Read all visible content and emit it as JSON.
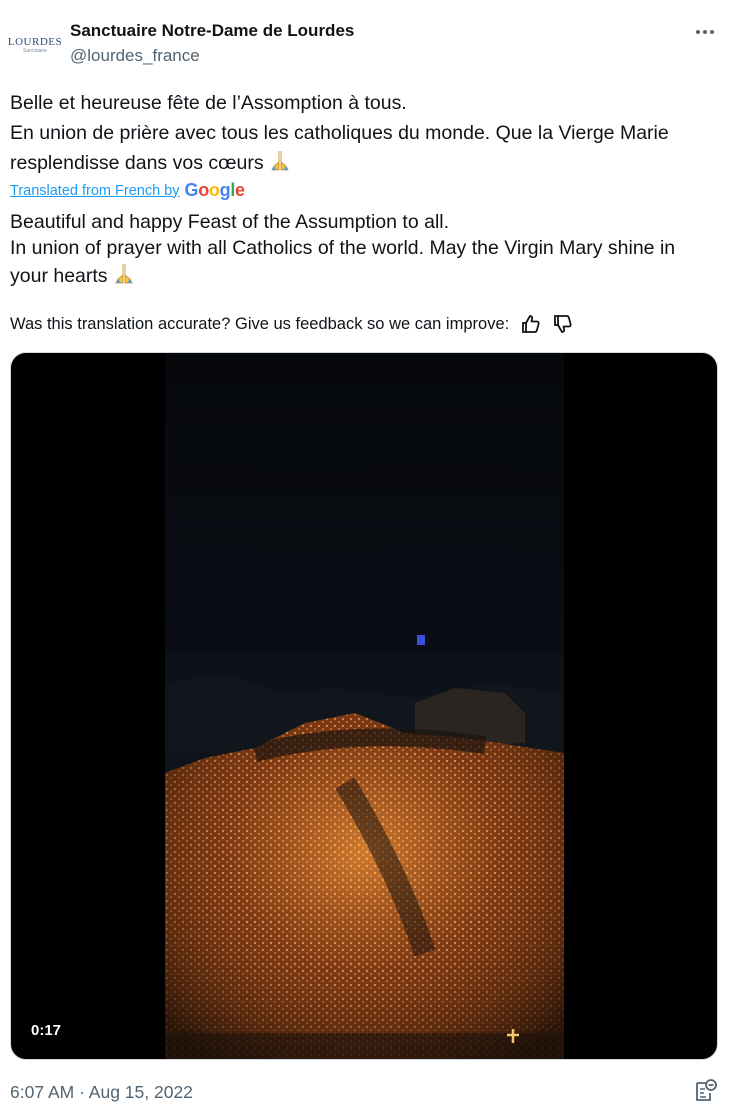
{
  "author": {
    "name": "Sanctuaire Notre-Dame de Lourdes",
    "handle": "@lourdes_france",
    "avatar_logo": "LOURDES",
    "avatar_sub": "Sanctuaire",
    "avatar_icon": "lourdes-logo"
  },
  "tweet": {
    "original_lines": [
      "Belle et heureuse fête de l’Assomption à tous.",
      "En union de prière avec tous les catholiques du monde. Que la Vierge Marie resplendisse dans vos cœurs"
    ],
    "translated_from": "Translated from French by",
    "translator": "Google",
    "translation_lines": [
      "Beautiful and happy Feast of the Assumption to all.",
      "In union of prayer with all Catholics of the world. May the Virgin Mary shine in your hearts"
    ],
    "emoji": "folded-hands-emoji"
  },
  "feedback": {
    "prompt": "Was this translation accurate? Give us feedback so we can improve:",
    "like_icon": "thumbs-up-icon",
    "dislike_icon": "thumbs-down-icon"
  },
  "media": {
    "type": "video",
    "duration": "0:17"
  },
  "post": {
    "time": "6:07 AM · Aug 15, 2022"
  },
  "colors": {
    "link": "#1d9bf0",
    "secondary_text": "#536471",
    "primary_text": "#0f1419"
  }
}
